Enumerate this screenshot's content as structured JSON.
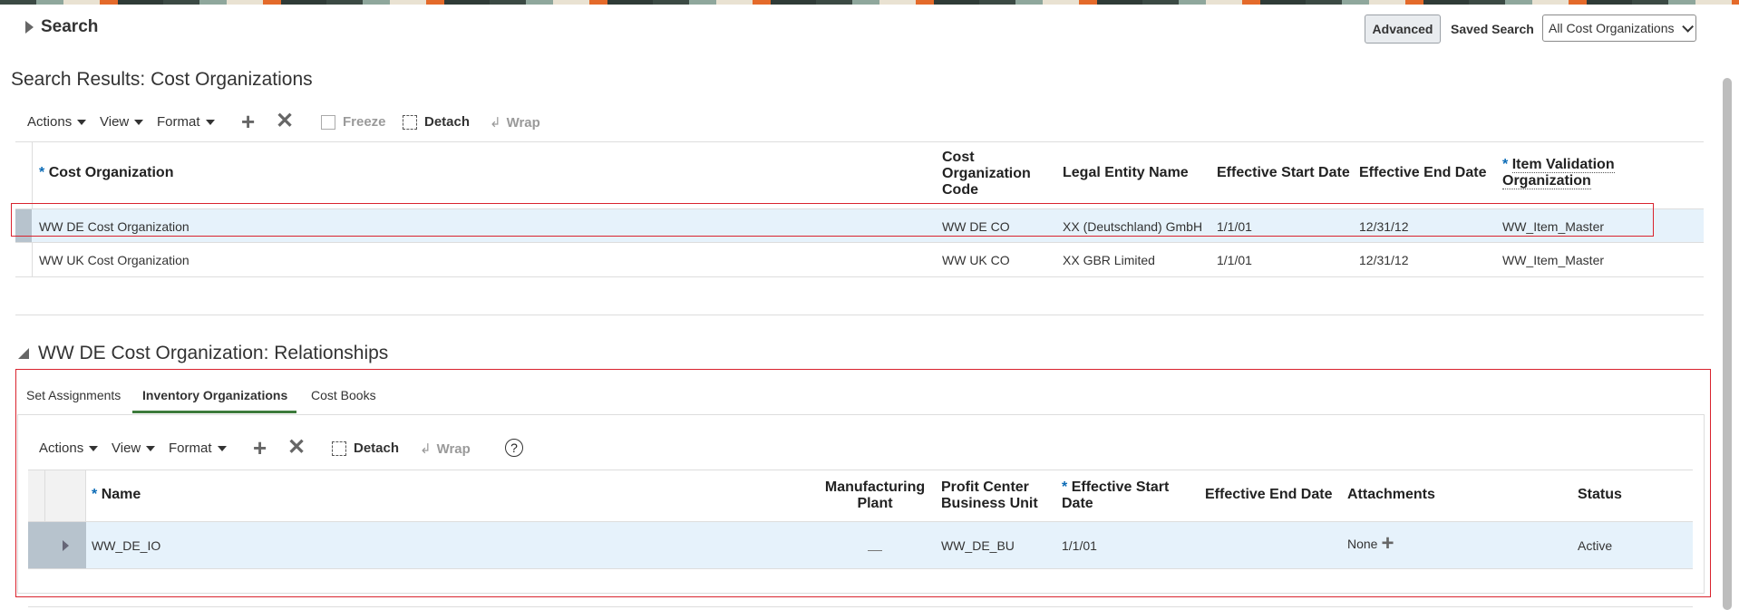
{
  "search": {
    "title": "Search",
    "advanced_label": "Advanced",
    "saved_search_label": "Saved Search",
    "saved_search_value": "All Cost Organizations"
  },
  "results": {
    "title": "Search Results: Cost Organizations",
    "toolbar": {
      "actions": "Actions",
      "view": "View",
      "format": "Format",
      "freeze": "Freeze",
      "detach": "Detach",
      "wrap": "Wrap"
    },
    "columns": [
      "Cost Organization",
      "Cost Organization Code",
      "Legal Entity Name",
      "Effective Start Date",
      "Effective End Date",
      "Item Validation Organization"
    ],
    "rows": [
      {
        "name": "WW DE Cost Organization",
        "code": "WW DE CO",
        "legal": "XX (Deutschland) GmbH",
        "start": "1/1/01",
        "end": "12/31/12",
        "ivo": "WW_Item_Master"
      },
      {
        "name": "WW UK Cost Organization",
        "code": "WW UK CO",
        "legal": "XX GBR Limited",
        "start": "1/1/01",
        "end": "12/31/12",
        "ivo": "WW_Item_Master"
      }
    ]
  },
  "relationships": {
    "title": "WW DE Cost Organization: Relationships",
    "tabs": [
      "Set Assignments",
      "Inventory Organizations",
      "Cost Books"
    ],
    "toolbar": {
      "actions": "Actions",
      "view": "View",
      "format": "Format",
      "detach": "Detach",
      "wrap": "Wrap",
      "help": "?"
    },
    "columns": {
      "name": "Name",
      "mfg1": "Manufacturing",
      "mfg2": "Plant",
      "pcbu1": "Profit Center",
      "pcbu2": "Business Unit",
      "start1": "Effective Start",
      "start2": "Date",
      "end": "Effective End Date",
      "attachments": "Attachments",
      "status": "Status"
    },
    "rows": [
      {
        "name": "WW_DE_IO",
        "pcbu": "WW_DE_BU",
        "start": "1/1/01",
        "end": "",
        "attachments": "None",
        "status": "Active"
      }
    ]
  },
  "star": "*"
}
